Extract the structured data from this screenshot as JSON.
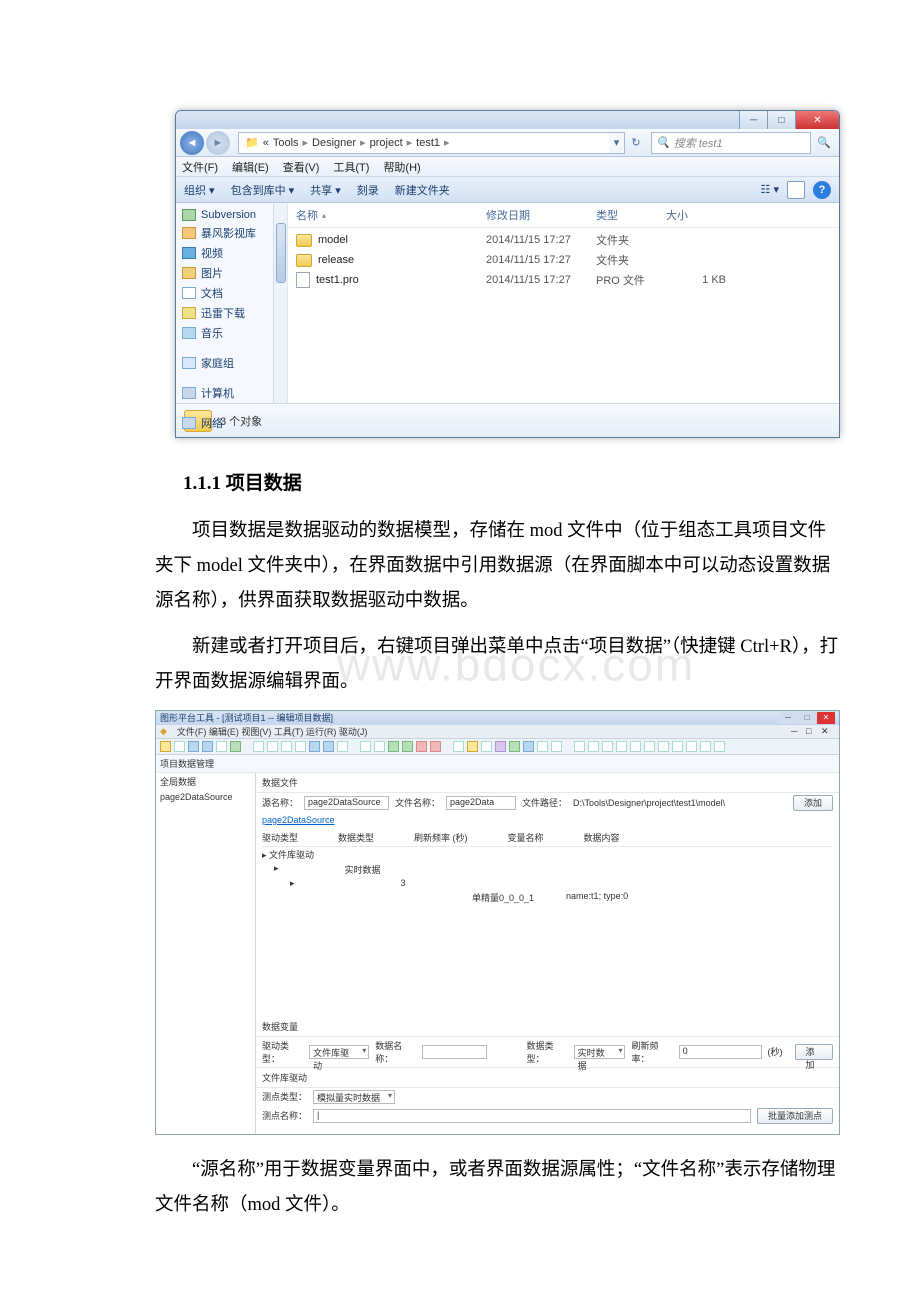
{
  "explorer": {
    "breadcrumb": [
      "«",
      "Tools",
      "Designer",
      "project",
      "test1"
    ],
    "search_placeholder": "搜索 test1",
    "menus": [
      "文件(F)",
      "编辑(E)",
      "查看(V)",
      "工具(T)",
      "帮助(H)"
    ],
    "toolbar": [
      "组织 ▾",
      "包含到库中 ▾",
      "共享 ▾",
      "刻录",
      "新建文件夹"
    ],
    "view_label": "☷ ▾",
    "nav_items": [
      "Subversion",
      "暴风影视库",
      "视频",
      "图片",
      "文档",
      "迅雷下载",
      "音乐"
    ],
    "nav_groups": [
      "家庭组",
      "计算机",
      "网络"
    ],
    "nav_up": "▲",
    "columns": {
      "name": "名称",
      "date": "修改日期",
      "type": "类型",
      "size": "大小"
    },
    "files": [
      {
        "name": "model",
        "date": "2014/11/15 17:27",
        "type": "文件夹",
        "size": "",
        "icon": "folder"
      },
      {
        "name": "release",
        "date": "2014/11/15 17:27",
        "type": "文件夹",
        "size": "",
        "icon": "folder"
      },
      {
        "name": "test1.pro",
        "date": "2014/11/15 17:27",
        "type": "PRO 文件",
        "size": "1 KB",
        "icon": "file"
      }
    ],
    "status": "3 个对象"
  },
  "doc": {
    "heading": "1.1.1 项目数据",
    "p1": "项目数据是数据驱动的数据模型，存储在 mod 文件中（位于组态工具项目文件夹下 model 文件夹中），在界面数据中引用数据源（在界面脚本中可以动态设置数据源名称），供界面获取数据驱动中数据。",
    "p2": "新建或者打开项目后，右键项目弹出菜单中点击“项目数据”（快捷键 Ctrl+R），打开界面数据源编辑界面。",
    "p3": "“源名称”用于数据变量界面中，或者界面数据源属性；“文件名称”表示存储物理文件名称（mod 文件）。",
    "watermark": "www.bdocx.com"
  },
  "designer": {
    "title": "图形平台工具 - [测试项目1 -- 编辑项目数据]",
    "sub": "文件(F)   编辑(E)   视图(V)   工具(T)   运行(R)   驱动(J)",
    "nav_title": "项目数据管理",
    "nav_items": [
      "全局数据",
      "page2DataSource"
    ],
    "file_h": "数据文件",
    "src_label": "源名称：",
    "src_val": "page2DataSource",
    "fn_label": "文件名称：",
    "fn_val": "page2Data",
    "fp_label": "文件路径：",
    "fp_val": "D:\\Tools\\Designer\\project\\test1\\model\\",
    "add": "添加",
    "src_link": "page2DataSource",
    "tree_cols": [
      "驱动类型",
      "数据类型",
      "刷新频率 (秒)",
      "变量名称",
      "数据内容"
    ],
    "tree": {
      "l1": "▸ 文件库驱动",
      "l2": "实时数据",
      "l2n": "3",
      "l3a": "单精量0_0_0_1",
      "l3b": "name:t1; type:0"
    },
    "var_h": "数据变量",
    "drv_type_l": "驱动类型：",
    "drv_type_v": "文件库驱动",
    "drv_name_l": "数据名称：",
    "drv_name_v": "",
    "dat_type_l": "数据类型：",
    "dat_type_v": "实时数据",
    "freq_l": "刷新频率：",
    "freq_v": "0",
    "freq_u": "(秒)",
    "file_drv_h": "文件库驱动",
    "pt_type_l": "测点类型：",
    "pt_type_v": "模拟量实时数据",
    "pt_name_l": "测点名称：",
    "pt_name_v": "|",
    "batch": "批量添加测点"
  }
}
